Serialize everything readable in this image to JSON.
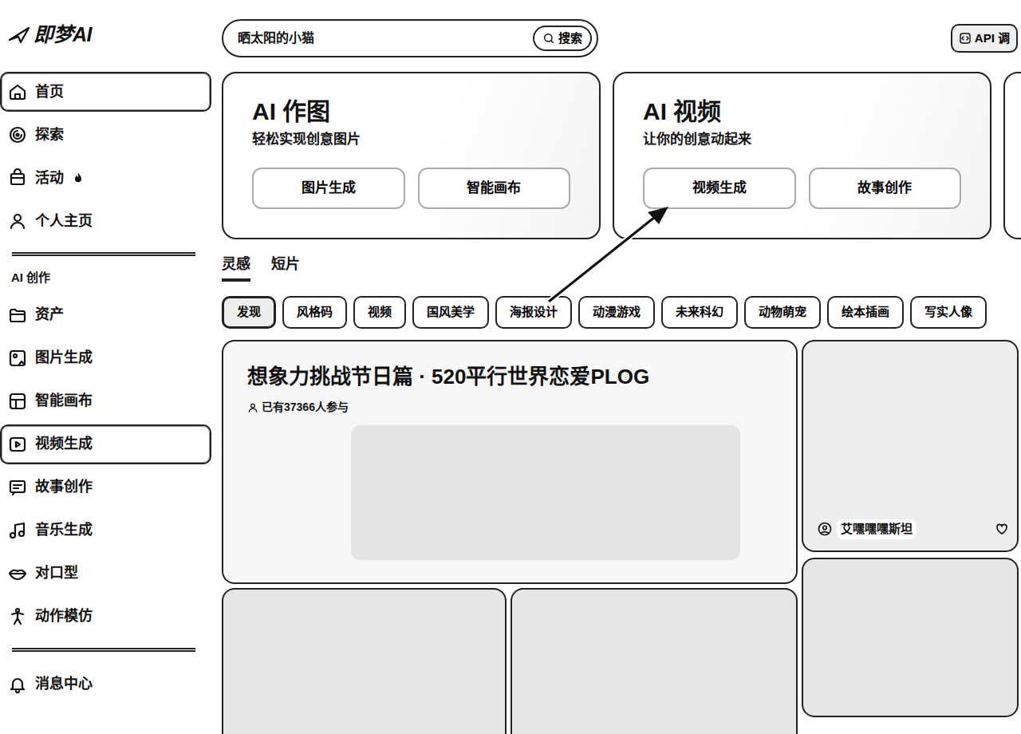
{
  "logo": "即梦AI",
  "search": {
    "value": "晒太阳的小猫",
    "button": "搜索"
  },
  "api_button": "API 调",
  "sidebar": {
    "top_items": [
      {
        "label": "首页",
        "selected": true
      },
      {
        "label": "探索",
        "selected": false
      },
      {
        "label": "活动",
        "selected": false
      },
      {
        "label": "个人主页",
        "selected": false
      }
    ],
    "section_label": "AI 创作",
    "creation_items": [
      {
        "label": "资产",
        "selected": false
      },
      {
        "label": "图片生成",
        "selected": false
      },
      {
        "label": "智能画布",
        "selected": false
      },
      {
        "label": "视频生成",
        "selected": true
      },
      {
        "label": "故事创作",
        "selected": false
      },
      {
        "label": "音乐生成",
        "selected": false
      },
      {
        "label": "对口型",
        "selected": false
      },
      {
        "label": "动作模仿",
        "selected": false
      }
    ],
    "bottom_items": [
      {
        "label": "消息中心",
        "selected": false
      }
    ]
  },
  "hero_cards": [
    {
      "title": "AI 作图",
      "subtitle": "轻松实现创意图片",
      "buttons": [
        "图片生成",
        "智能画布"
      ]
    },
    {
      "title": "AI 视频",
      "subtitle": "让你的创意动起来",
      "buttons": [
        "视频生成",
        "故事创作"
      ]
    }
  ],
  "tabs": [
    {
      "label": "灵感",
      "selected": true
    },
    {
      "label": "短片",
      "selected": false
    }
  ],
  "chips": [
    {
      "label": "发现",
      "selected": true
    },
    {
      "label": "风格码",
      "selected": false
    },
    {
      "label": "视频",
      "selected": false
    },
    {
      "label": "国风美学",
      "selected": false
    },
    {
      "label": "海报设计",
      "selected": false
    },
    {
      "label": "动漫游戏",
      "selected": false
    },
    {
      "label": "未来科幻",
      "selected": false
    },
    {
      "label": "动物萌宠",
      "selected": false
    },
    {
      "label": "绘本插画",
      "selected": false
    },
    {
      "label": "写实人像",
      "selected": false
    }
  ],
  "feed": {
    "featured": {
      "title": "想象力挑战节日篇 · 520平行世界恋爱PLOG",
      "participants": "已有37366人参与"
    },
    "side_card": {
      "user": "艾嘿嘿嘿斯坦"
    }
  }
}
